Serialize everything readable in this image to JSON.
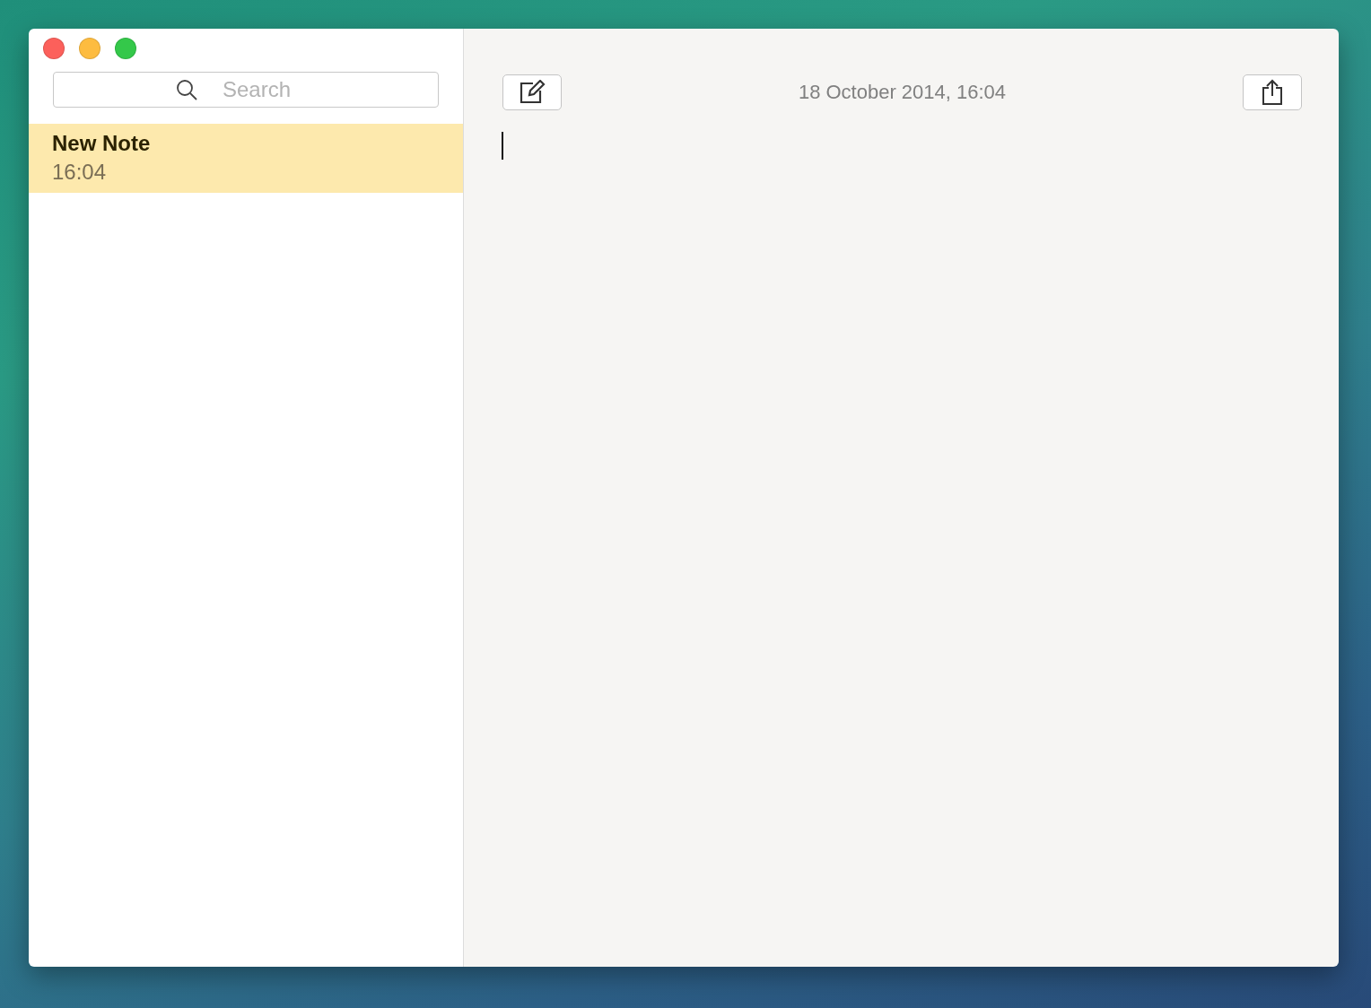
{
  "search": {
    "placeholder": "Search"
  },
  "notes": [
    {
      "title": "New Note",
      "time": "16:04",
      "selected": true
    }
  ],
  "toolbar": {
    "date": "18 October 2014, 16:04"
  }
}
